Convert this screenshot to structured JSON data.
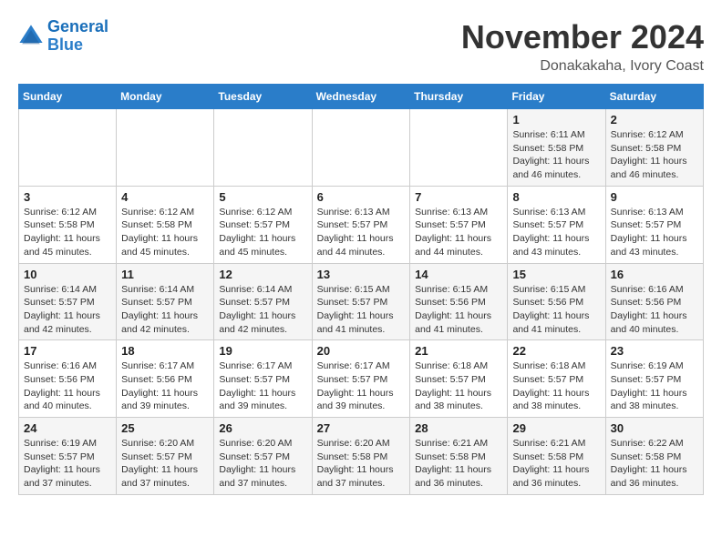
{
  "logo": {
    "text_general": "General",
    "text_blue": "Blue"
  },
  "header": {
    "month": "November 2024",
    "location": "Donakakaha, Ivory Coast"
  },
  "weekdays": [
    "Sunday",
    "Monday",
    "Tuesday",
    "Wednesday",
    "Thursday",
    "Friday",
    "Saturday"
  ],
  "weeks": [
    [
      {
        "day": "",
        "info": ""
      },
      {
        "day": "",
        "info": ""
      },
      {
        "day": "",
        "info": ""
      },
      {
        "day": "",
        "info": ""
      },
      {
        "day": "",
        "info": ""
      },
      {
        "day": "1",
        "info": "Sunrise: 6:11 AM\nSunset: 5:58 PM\nDaylight: 11 hours and 46 minutes."
      },
      {
        "day": "2",
        "info": "Sunrise: 6:12 AM\nSunset: 5:58 PM\nDaylight: 11 hours and 46 minutes."
      }
    ],
    [
      {
        "day": "3",
        "info": "Sunrise: 6:12 AM\nSunset: 5:58 PM\nDaylight: 11 hours and 45 minutes."
      },
      {
        "day": "4",
        "info": "Sunrise: 6:12 AM\nSunset: 5:58 PM\nDaylight: 11 hours and 45 minutes."
      },
      {
        "day": "5",
        "info": "Sunrise: 6:12 AM\nSunset: 5:57 PM\nDaylight: 11 hours and 45 minutes."
      },
      {
        "day": "6",
        "info": "Sunrise: 6:13 AM\nSunset: 5:57 PM\nDaylight: 11 hours and 44 minutes."
      },
      {
        "day": "7",
        "info": "Sunrise: 6:13 AM\nSunset: 5:57 PM\nDaylight: 11 hours and 44 minutes."
      },
      {
        "day": "8",
        "info": "Sunrise: 6:13 AM\nSunset: 5:57 PM\nDaylight: 11 hours and 43 minutes."
      },
      {
        "day": "9",
        "info": "Sunrise: 6:13 AM\nSunset: 5:57 PM\nDaylight: 11 hours and 43 minutes."
      }
    ],
    [
      {
        "day": "10",
        "info": "Sunrise: 6:14 AM\nSunset: 5:57 PM\nDaylight: 11 hours and 42 minutes."
      },
      {
        "day": "11",
        "info": "Sunrise: 6:14 AM\nSunset: 5:57 PM\nDaylight: 11 hours and 42 minutes."
      },
      {
        "day": "12",
        "info": "Sunrise: 6:14 AM\nSunset: 5:57 PM\nDaylight: 11 hours and 42 minutes."
      },
      {
        "day": "13",
        "info": "Sunrise: 6:15 AM\nSunset: 5:57 PM\nDaylight: 11 hours and 41 minutes."
      },
      {
        "day": "14",
        "info": "Sunrise: 6:15 AM\nSunset: 5:56 PM\nDaylight: 11 hours and 41 minutes."
      },
      {
        "day": "15",
        "info": "Sunrise: 6:15 AM\nSunset: 5:56 PM\nDaylight: 11 hours and 41 minutes."
      },
      {
        "day": "16",
        "info": "Sunrise: 6:16 AM\nSunset: 5:56 PM\nDaylight: 11 hours and 40 minutes."
      }
    ],
    [
      {
        "day": "17",
        "info": "Sunrise: 6:16 AM\nSunset: 5:56 PM\nDaylight: 11 hours and 40 minutes."
      },
      {
        "day": "18",
        "info": "Sunrise: 6:17 AM\nSunset: 5:56 PM\nDaylight: 11 hours and 39 minutes."
      },
      {
        "day": "19",
        "info": "Sunrise: 6:17 AM\nSunset: 5:57 PM\nDaylight: 11 hours and 39 minutes."
      },
      {
        "day": "20",
        "info": "Sunrise: 6:17 AM\nSunset: 5:57 PM\nDaylight: 11 hours and 39 minutes."
      },
      {
        "day": "21",
        "info": "Sunrise: 6:18 AM\nSunset: 5:57 PM\nDaylight: 11 hours and 38 minutes."
      },
      {
        "day": "22",
        "info": "Sunrise: 6:18 AM\nSunset: 5:57 PM\nDaylight: 11 hours and 38 minutes."
      },
      {
        "day": "23",
        "info": "Sunrise: 6:19 AM\nSunset: 5:57 PM\nDaylight: 11 hours and 38 minutes."
      }
    ],
    [
      {
        "day": "24",
        "info": "Sunrise: 6:19 AM\nSunset: 5:57 PM\nDaylight: 11 hours and 37 minutes."
      },
      {
        "day": "25",
        "info": "Sunrise: 6:20 AM\nSunset: 5:57 PM\nDaylight: 11 hours and 37 minutes."
      },
      {
        "day": "26",
        "info": "Sunrise: 6:20 AM\nSunset: 5:57 PM\nDaylight: 11 hours and 37 minutes."
      },
      {
        "day": "27",
        "info": "Sunrise: 6:20 AM\nSunset: 5:58 PM\nDaylight: 11 hours and 37 minutes."
      },
      {
        "day": "28",
        "info": "Sunrise: 6:21 AM\nSunset: 5:58 PM\nDaylight: 11 hours and 36 minutes."
      },
      {
        "day": "29",
        "info": "Sunrise: 6:21 AM\nSunset: 5:58 PM\nDaylight: 11 hours and 36 minutes."
      },
      {
        "day": "30",
        "info": "Sunrise: 6:22 AM\nSunset: 5:58 PM\nDaylight: 11 hours and 36 minutes."
      }
    ]
  ]
}
